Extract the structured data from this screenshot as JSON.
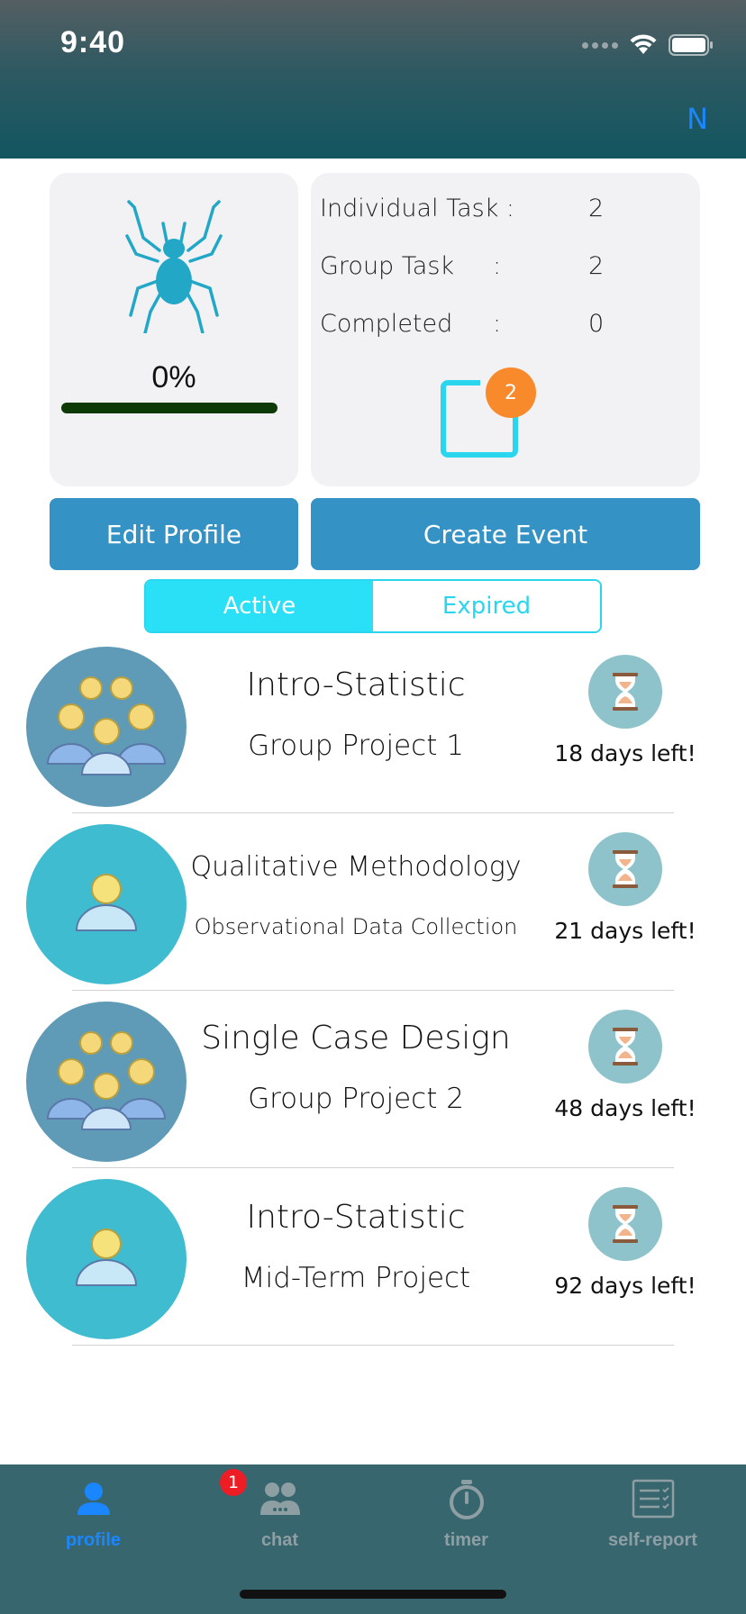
{
  "status_bar": {
    "time": "9:40"
  },
  "nav": {
    "right_label": "N"
  },
  "profile_card": {
    "progress_text": "0%",
    "progress_value": 0
  },
  "stats": {
    "rows": [
      {
        "label": "Individual Task :",
        "colon": "",
        "value": "2"
      },
      {
        "label": "Group Task",
        "colon": ":",
        "value": "2"
      },
      {
        "label": "Completed",
        "colon": ":",
        "value": "0"
      }
    ],
    "badge_count": "2"
  },
  "actions": {
    "edit_profile": "Edit Profile",
    "create_event": "Create Event"
  },
  "segment": {
    "active": "Active",
    "expired": "Expired",
    "selected": "Active"
  },
  "events": [
    {
      "type": "group",
      "title": "Intro-Statistic",
      "subtitle": "Group Project 1",
      "days_left": "18 days left!"
    },
    {
      "type": "single",
      "title": "Qualitative Methodology",
      "subtitle": "Observational Data Collection",
      "days_left": "21 days left!"
    },
    {
      "type": "group",
      "title": "Single Case Design",
      "subtitle": "Group Project 2",
      "days_left": "48 days left!"
    },
    {
      "type": "single",
      "title": "Intro-Statistic",
      "subtitle": "Mid-Term Project",
      "days_left": "92 days left!"
    }
  ],
  "tabbar": {
    "tabs": [
      {
        "label": "profile",
        "icon": "person-icon",
        "active": true
      },
      {
        "label": "chat",
        "icon": "chat-people-icon",
        "active": false,
        "badge": "1"
      },
      {
        "label": "timer",
        "icon": "stopwatch-icon",
        "active": false
      },
      {
        "label": "self-report",
        "icon": "checklist-icon",
        "active": false
      }
    ]
  },
  "colors": {
    "accent": "#3493c4",
    "segment_active": "#2ae0f6",
    "badge_orange": "#f88a2b",
    "tab_active": "#1a86ff",
    "tab_bar": "#38666f"
  }
}
